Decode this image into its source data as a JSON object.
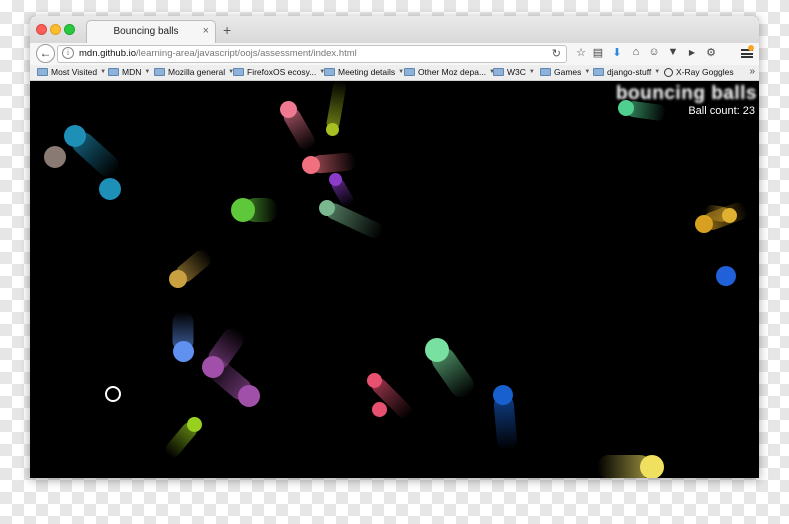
{
  "browser": {
    "tab_title": "Bouncing balls",
    "tab_close": "×",
    "new_tab": "+",
    "url_host": "mdn.github.io",
    "url_path": "/learning-area/javascript/oojs/assessment/index.html",
    "back_icon": "arrow-left-icon",
    "toolbar_icons": [
      "star-icon",
      "reading-list-icon",
      "download-icon",
      "home-icon",
      "chat-icon",
      "pocket-icon",
      "youtube-icon",
      "settings-icon"
    ],
    "bookmarks": [
      {
        "label": "Most Visited",
        "dropdown": true
      },
      {
        "label": "MDN",
        "dropdown": true
      },
      {
        "label": "Mozilla general",
        "dropdown": true
      },
      {
        "label": "FirefoxOS ecosy...",
        "dropdown": true
      },
      {
        "label": "Meeting details",
        "dropdown": true
      },
      {
        "label": "Other Moz depa...",
        "dropdown": true
      },
      {
        "label": "W3C",
        "dropdown": true
      },
      {
        "label": "Games",
        "dropdown": true
      },
      {
        "label": "django-stuff",
        "dropdown": true
      },
      {
        "label": "X-Ray Goggles",
        "dropdown": false
      }
    ],
    "overflow": "»"
  },
  "page": {
    "heading": "bouncing balls",
    "ball_count_text": "Ball count: 23",
    "background": "#000000",
    "balls": [
      {
        "name": "ball-teal-left",
        "color": "#1e90b8"
      },
      {
        "name": "ball-teal-trail",
        "color": "#1e90b8"
      },
      {
        "name": "ball-brown-left",
        "color": "#8a7a74"
      },
      {
        "name": "ball-pink-top",
        "color": "#f07890"
      },
      {
        "name": "ball-olive-top",
        "color": "#a8c020"
      },
      {
        "name": "ball-salmon",
        "color": "#f07080"
      },
      {
        "name": "ball-purple-small",
        "color": "#8a3cc8"
      },
      {
        "name": "ball-green-mid",
        "color": "#5ec83a"
      },
      {
        "name": "ball-sage",
        "color": "#7ab890"
      },
      {
        "name": "ball-mint-top-right",
        "color": "#50d090"
      },
      {
        "name": "ball-orange-right",
        "color": "#d8a020"
      },
      {
        "name": "ball-blue-right",
        "color": "#2060d8"
      },
      {
        "name": "ball-gold-left",
        "color": "#c8a040"
      },
      {
        "name": "ball-periwinkle",
        "color": "#6090f0"
      },
      {
        "name": "ball-violet-1",
        "color": "#a050a8"
      },
      {
        "name": "ball-violet-2",
        "color": "#a050a8"
      },
      {
        "name": "ball-lime-bottom",
        "color": "#98d020"
      },
      {
        "name": "ball-mint-center",
        "color": "#78e0a0"
      },
      {
        "name": "ball-red-1",
        "color": "#e85070"
      },
      {
        "name": "ball-red-2",
        "color": "#e85070"
      },
      {
        "name": "ball-blue-bottom",
        "color": "#1860d0"
      },
      {
        "name": "ball-yellow-bottom",
        "color": "#f0e060"
      },
      {
        "name": "ball-yellow-small",
        "color": "#e0b030"
      }
    ],
    "evil_circle_color": "#ffffff"
  }
}
